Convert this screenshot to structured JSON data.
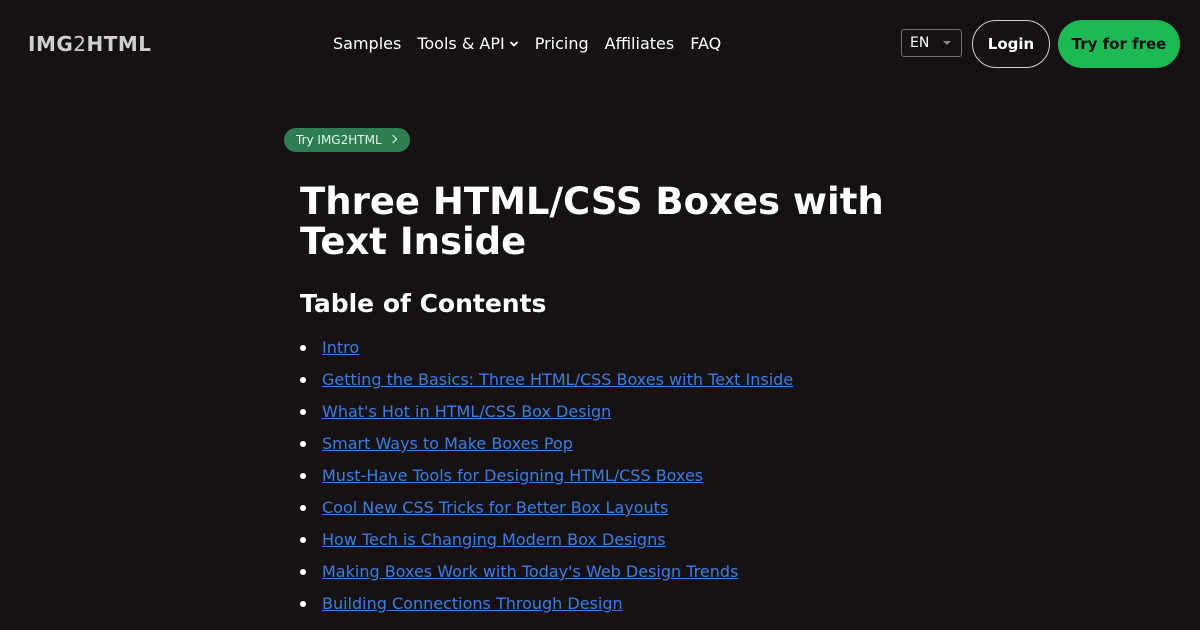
{
  "header": {
    "logo": {
      "part1": "IMG",
      "part2": "2",
      "part3": "HTML"
    },
    "nav": [
      "Samples",
      "Tools & API",
      "Pricing",
      "Affiliates",
      "FAQ"
    ],
    "language": "EN",
    "login_label": "Login",
    "try_label": "Try for free"
  },
  "badge": {
    "label": "Try IMG2HTML"
  },
  "article": {
    "title": "Three HTML/CSS Boxes with Text Inside",
    "toc_heading": "Table of Contents",
    "toc": [
      "Intro",
      "Getting the Basics: Three HTML/CSS Boxes with Text Inside",
      "What's Hot in HTML/CSS Box Design",
      "Smart Ways to Make Boxes Pop",
      "Must-Have Tools for Designing HTML/CSS Boxes",
      "Cool New CSS Tricks for Better Box Layouts",
      "How Tech is Changing Modern Box Designs",
      "Making Boxes Work with Today's Web Design Trends",
      "Building Connections Through Design"
    ]
  },
  "colors": {
    "background": "#161213",
    "accent_green": "#1db954",
    "badge_green": "#2f7d52",
    "link_blue": "#3b7de3"
  }
}
